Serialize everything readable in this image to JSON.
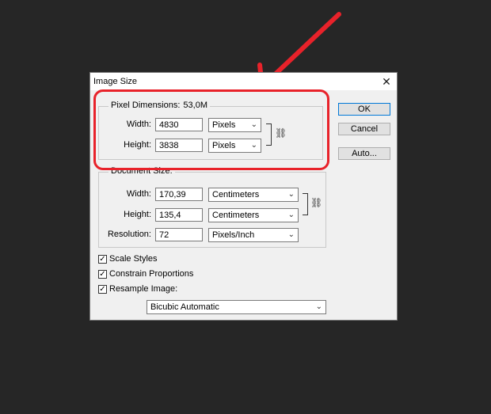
{
  "dialog": {
    "title": "Image Size",
    "close_icon": "close-icon",
    "buttons": {
      "ok": "OK",
      "cancel": "Cancel",
      "auto": "Auto..."
    },
    "pixel_dimensions": {
      "title": "Pixel Dimensions:",
      "value": "53,0M",
      "width_label": "Width:",
      "width_value": "4830",
      "width_unit": "Pixels",
      "height_label": "Height:",
      "height_value": "3838",
      "height_unit": "Pixels"
    },
    "document_size": {
      "title": "Document Size:",
      "width_label": "Width:",
      "width_value": "170,39",
      "width_unit": "Centimeters",
      "height_label": "Height:",
      "height_value": "135,4",
      "height_unit": "Centimeters",
      "resolution_label": "Resolution:",
      "resolution_value": "72",
      "resolution_unit": "Pixels/Inch"
    },
    "options": {
      "scale_styles": {
        "label": "Scale Styles",
        "checked": true
      },
      "constrain_proportions": {
        "label": "Constrain Proportions",
        "checked": true
      },
      "resample_image": {
        "label": "Resample Image:",
        "checked": true
      },
      "resample_method": "Bicubic Automatic"
    }
  },
  "annotation": {
    "highlight_color": "#e8222a"
  }
}
